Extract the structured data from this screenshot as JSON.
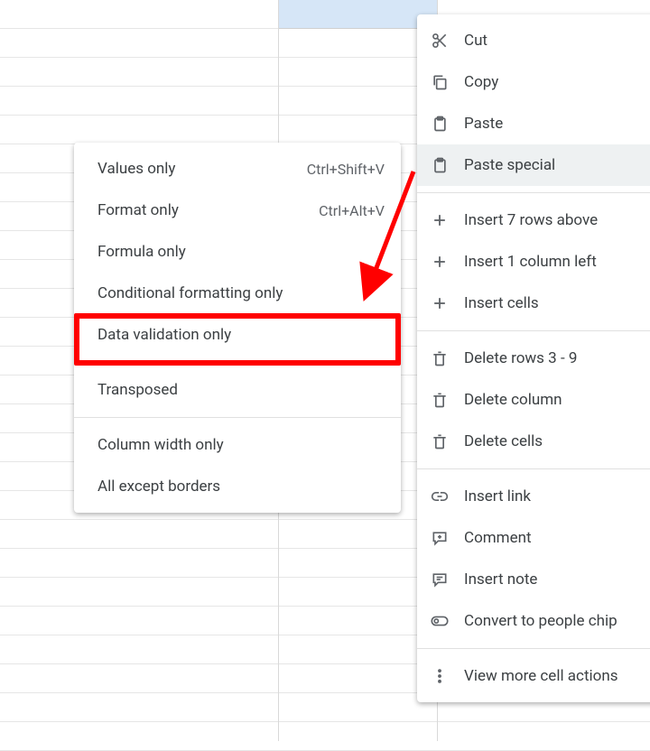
{
  "context_menu": {
    "cut": "Cut",
    "copy": "Copy",
    "paste": "Paste",
    "paste_special": "Paste special",
    "insert_rows": "Insert 7 rows above",
    "insert_col": "Insert 1 column left",
    "insert_cells": "Insert cells",
    "delete_rows": "Delete rows 3 - 9",
    "delete_col": "Delete column",
    "delete_cells": "Delete cells",
    "insert_link": "Insert link",
    "comment": "Comment",
    "insert_note": "Insert note",
    "people_chip": "Convert to people chip",
    "more": "View more cell actions"
  },
  "submenu": {
    "values_only": {
      "label": "Values only",
      "shortcut": "Ctrl+Shift+V"
    },
    "format_only": {
      "label": "Format only",
      "shortcut": "Ctrl+Alt+V"
    },
    "formula_only": {
      "label": "Formula only"
    },
    "cond_fmt": {
      "label": "Conditional formatting only"
    },
    "data_validation": {
      "label": "Data validation only"
    },
    "transposed": {
      "label": "Transposed"
    },
    "col_width": {
      "label": "Column width only"
    },
    "all_except_borders": {
      "label": "All except borders"
    }
  },
  "annotation": {
    "color": "#ff0000"
  }
}
